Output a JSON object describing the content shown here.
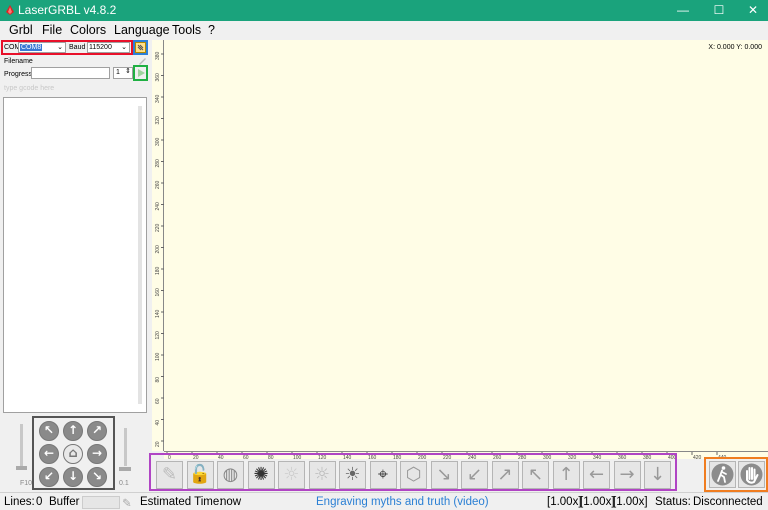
{
  "window": {
    "title": "LaserGRBL v4.8.2",
    "minimize": "—",
    "maximize": "☐",
    "close": "✕"
  },
  "menu": [
    "Grbl",
    "File",
    "Colors",
    "Language",
    "Tools",
    "?"
  ],
  "connection": {
    "com_label": "COM",
    "com_value": "COM8",
    "baud_label": "Baud",
    "baud_value": "115200"
  },
  "file": {
    "filename_label": "Filename",
    "progress_label": "Progress",
    "copies_value": "1"
  },
  "gcode": {
    "placeholder": "type gcode here"
  },
  "coords": "X: 0.000 Y: 0.000",
  "jog": {
    "speed_label": "F10",
    "step_label": "0.1"
  },
  "ruler": {
    "x_ticks": [
      "0",
      "20",
      "40",
      "60",
      "80",
      "100",
      "120",
      "140",
      "160",
      "180",
      "200",
      "220",
      "240",
      "260",
      "280",
      "300",
      "320",
      "340",
      "360",
      "380",
      "400",
      "420",
      "440"
    ],
    "y_ticks": [
      "380",
      "360",
      "340",
      "320",
      "300",
      "280",
      "260",
      "240",
      "220",
      "200",
      "180",
      "160",
      "140",
      "120",
      "100",
      "80",
      "60",
      "40",
      "20"
    ]
  },
  "status": {
    "lines_label": "Lines:",
    "lines_value": "0",
    "buffer_label": "Buffer",
    "time_label": "Estimated Time:",
    "time_value": "now",
    "link": "Engraving myths and truth (video)",
    "overrides": [
      "[1.00x]",
      "[1.00x]",
      "[1.00x]"
    ],
    "status_label": "Status:",
    "status_value": "Disconnected"
  },
  "colors": {
    "titlebar": "#1aa37c",
    "canvas": "#fffde6",
    "link": "#2a7fd4"
  }
}
